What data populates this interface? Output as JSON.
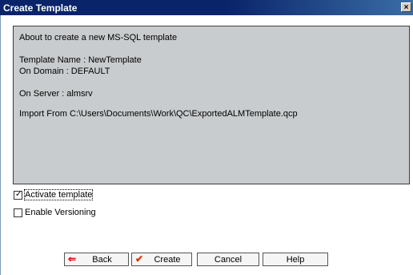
{
  "window": {
    "title": "Create Template",
    "close_glyph": "×"
  },
  "info": {
    "heading": "About to create a new MS-SQL template",
    "template_name": "Template Name : NewTemplate",
    "domain": "On Domain : DEFAULT",
    "server": "On Server : almsrv",
    "import_from": "Import From C:\\Users\\Documents\\Work\\QC\\ExportedALMTemplate.qcp"
  },
  "options": {
    "activate_label": "Activate template",
    "activate_checked": true,
    "versioning_label": "Enable Versioning",
    "versioning_checked": false
  },
  "buttons": {
    "back": "Back",
    "create": "Create",
    "cancel": "Cancel",
    "help": "Help"
  },
  "colors": {
    "title_bar": "#0a246a",
    "panel_bg": "#c9ccce",
    "back_arrow": "#d40000",
    "create_check": "#e03000"
  },
  "icons": {
    "back": "left-arrow-icon",
    "create": "checkmark-icon",
    "activate_check": "checkmark-icon"
  }
}
